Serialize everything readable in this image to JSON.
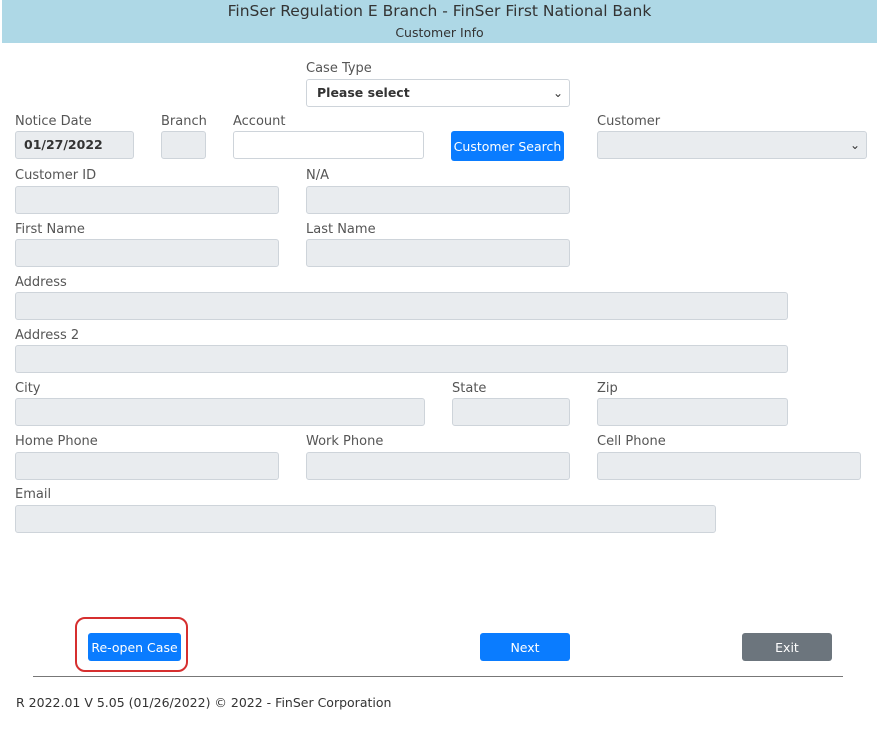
{
  "header": {
    "title": "FinSer Regulation E Branch - FinSer First National Bank",
    "subtitle": "Customer Info"
  },
  "form": {
    "case_type": {
      "label": "Case Type",
      "value": "Please select"
    },
    "notice_date": {
      "label": "Notice Date",
      "value": "01/27/2022"
    },
    "branch": {
      "label": "Branch",
      "value": ""
    },
    "account": {
      "label": "Account",
      "value": ""
    },
    "customer_search_label": "Customer Search",
    "customer": {
      "label": "Customer",
      "value": ""
    },
    "customer_id": {
      "label": "Customer ID",
      "value": ""
    },
    "na": {
      "label": "N/A",
      "value": ""
    },
    "first_name": {
      "label": "First Name",
      "value": ""
    },
    "last_name": {
      "label": "Last Name",
      "value": ""
    },
    "address": {
      "label": "Address",
      "value": ""
    },
    "address2": {
      "label": "Address 2",
      "value": ""
    },
    "city": {
      "label": "City",
      "value": ""
    },
    "state": {
      "label": "State",
      "value": ""
    },
    "zip": {
      "label": "Zip",
      "value": ""
    },
    "home_phone": {
      "label": "Home Phone",
      "value": ""
    },
    "work_phone": {
      "label": "Work Phone",
      "value": ""
    },
    "cell_phone": {
      "label": "Cell Phone",
      "value": ""
    },
    "email": {
      "label": "Email",
      "value": ""
    }
  },
  "actions": {
    "reopen_label": "Re-open Case",
    "next_label": "Next",
    "exit_label": "Exit"
  },
  "footer": {
    "text": "R 2022.01 V 5.05 (01/26/2022) © 2022 - FinSer Corporation"
  },
  "colors": {
    "header_bg": "#aed8e6",
    "primary": "#0a7cff",
    "secondary": "#6c757d",
    "highlight": "#d62f2f"
  }
}
